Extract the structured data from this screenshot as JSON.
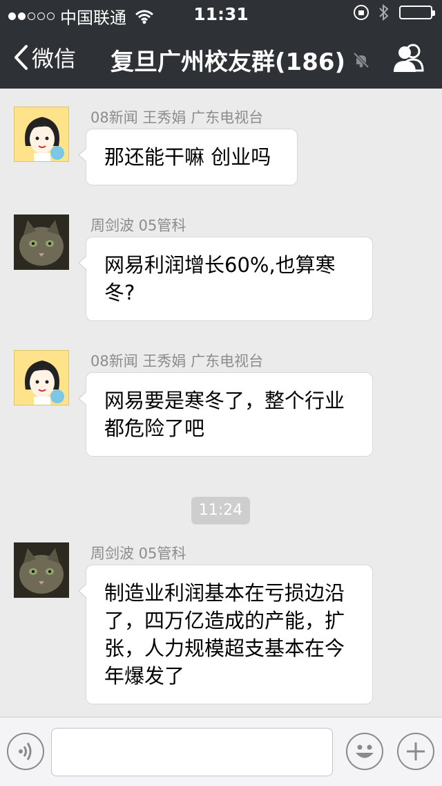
{
  "status_bar": {
    "carrier": "中国联通",
    "time": "11:31"
  },
  "nav": {
    "back_label": "微信",
    "title": "复旦广州校友群(186)"
  },
  "messages": [
    {
      "sender": "08新闻 王秀娟 广东电视台",
      "text": "那还能干嘛 创业吗"
    },
    {
      "sender": "周剑波 05管科",
      "text": "网易利润增长60%,也算寒冬?"
    },
    {
      "sender": "08新闻 王秀娟 广东电视台",
      "text": "网易要是寒冬了，整个行业都危险了吧"
    },
    {
      "sender": "周剑波 05管科",
      "text": "制造业利润基本在亏损边沿了，四万亿造成的产能，扩张，人力规模超支基本在今年爆发了"
    }
  ],
  "timestamp": "11:24",
  "icons": {
    "back": "chevron-left-icon",
    "mute": "bell-slash-icon",
    "group": "group-members-icon",
    "voice": "voice-icon",
    "emoji": "smiley-icon",
    "plus": "plus-icon"
  },
  "colors": {
    "nav_bg": "#2e3135",
    "chat_bg": "#ebebeb",
    "bubble_bg": "#ffffff",
    "sender_text": "#8c8c8c"
  }
}
